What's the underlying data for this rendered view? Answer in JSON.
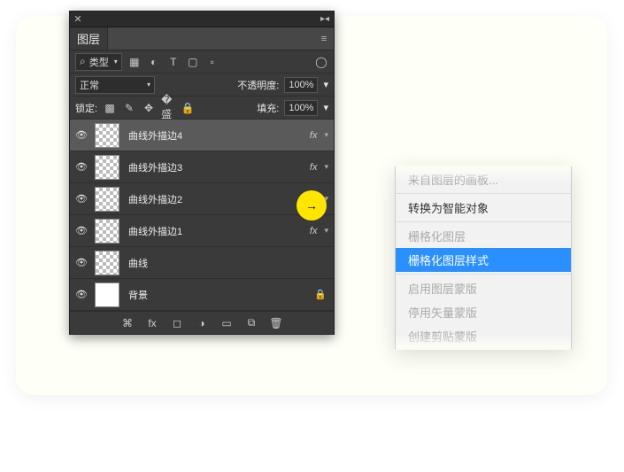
{
  "panel": {
    "title": "图层",
    "filter_label": "类型",
    "blend_mode": "正常",
    "opacity_label": "不透明度:",
    "opacity_value": "100%",
    "lock_label": "锁定:",
    "fill_label": "填充:",
    "fill_value": "100%",
    "layers": [
      {
        "name": "曲线外描边4",
        "visible": true,
        "has_fx": true,
        "selected": true,
        "thumb": "checker"
      },
      {
        "name": "曲线外描边3",
        "visible": true,
        "has_fx": true,
        "selected": false,
        "thumb": "checker"
      },
      {
        "name": "曲线外描边2",
        "visible": true,
        "has_fx": true,
        "selected": false,
        "thumb": "checker"
      },
      {
        "name": "曲线外描边1",
        "visible": true,
        "has_fx": true,
        "selected": false,
        "thumb": "checker"
      },
      {
        "name": "曲线",
        "visible": true,
        "has_fx": false,
        "selected": false,
        "thumb": "checker"
      },
      {
        "name": "背景",
        "visible": true,
        "has_fx": false,
        "selected": false,
        "thumb": "white",
        "locked": true
      }
    ],
    "fx_label": "fx"
  },
  "context_menu": {
    "items": [
      {
        "label": "来自图层的画板...",
        "state": "disabled"
      },
      {
        "label": "转换为智能对象",
        "state": "enabled"
      },
      {
        "label": "栅格化图层",
        "state": "disabled"
      },
      {
        "label": "栅格化图层样式",
        "state": "selected"
      },
      {
        "label": "启用图层蒙版",
        "state": "disabled"
      },
      {
        "label": "停用矢量蒙版",
        "state": "disabled"
      },
      {
        "label": "创建剪贴蒙版",
        "state": "disabled"
      }
    ]
  }
}
